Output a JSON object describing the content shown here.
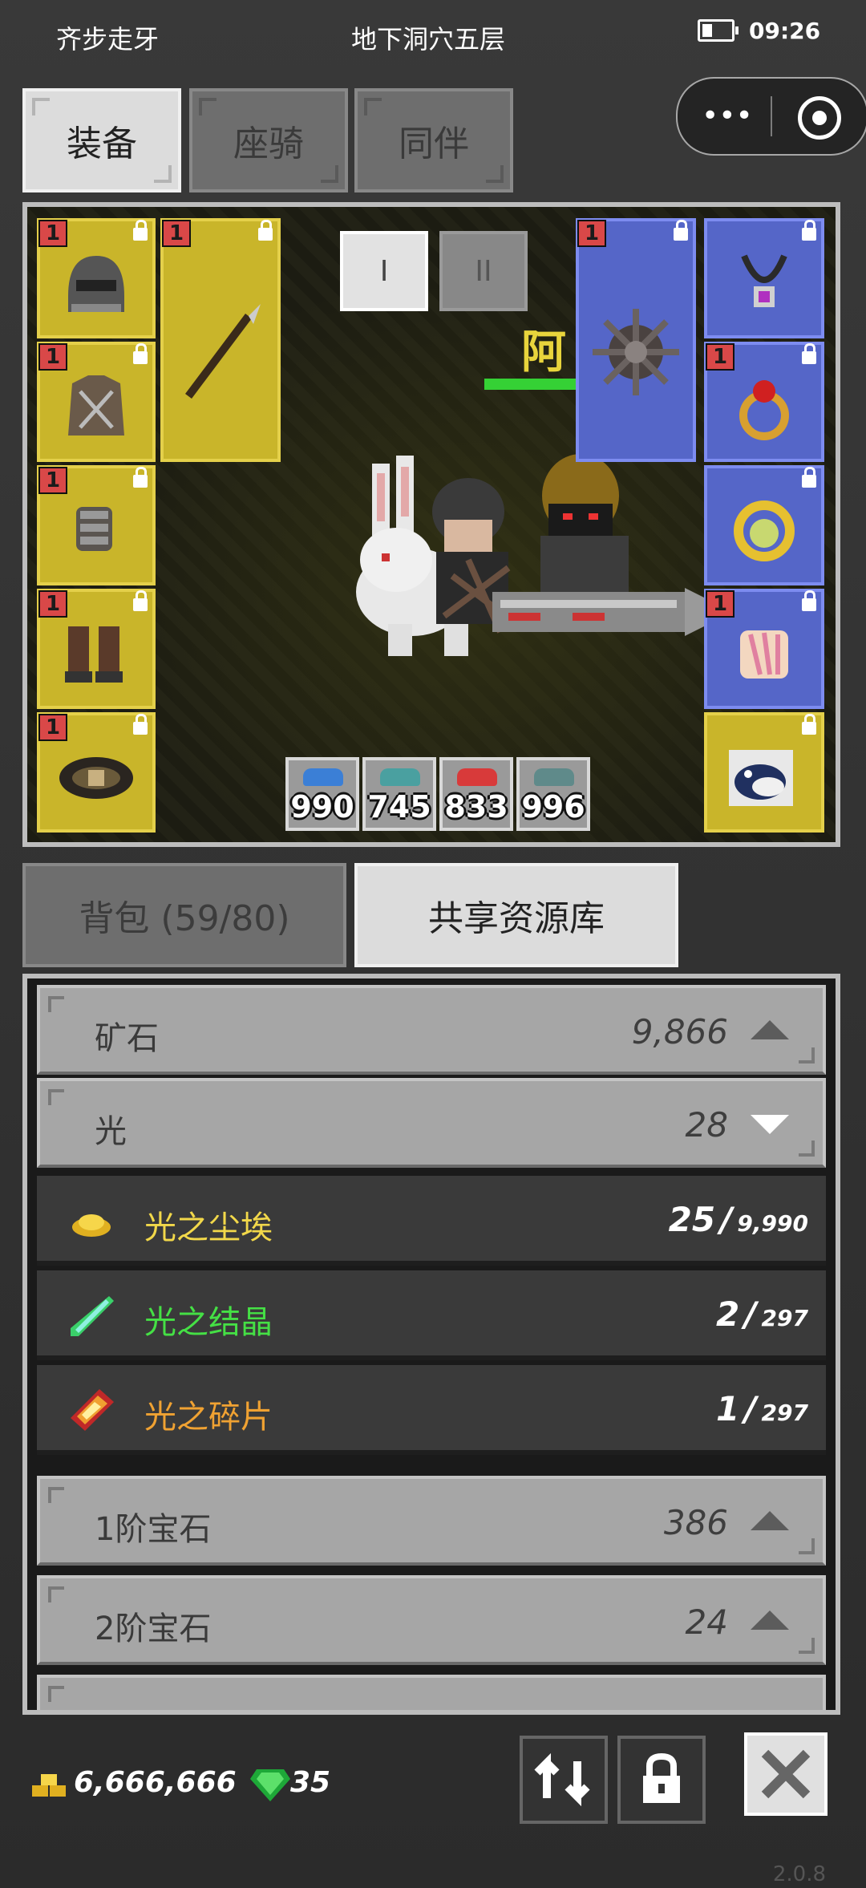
{
  "status_bar": {
    "left_text": "齐步走牙",
    "location": "地下洞穴五层",
    "time": "09:26"
  },
  "capsule": {
    "more_glyph": "•••"
  },
  "top_tabs": [
    {
      "label": "装备",
      "active": true
    },
    {
      "label": "座骑",
      "active": false
    },
    {
      "label": "同伴",
      "active": false
    }
  ],
  "equipment": {
    "page_tabs": [
      "I",
      "II"
    ],
    "character_name_partial": "阿",
    "left_slots": [
      {
        "type": "helmet",
        "level": "1"
      },
      {
        "type": "armor",
        "level": "1"
      },
      {
        "type": "gloves",
        "level": "1"
      },
      {
        "type": "boots",
        "level": "1"
      },
      {
        "type": "belt",
        "level": "1"
      }
    ],
    "weapon_slot": {
      "type": "spear",
      "level": "1"
    },
    "offhand_slot": {
      "type": "spiked-shield",
      "level": "1"
    },
    "right_slots": [
      {
        "type": "necklace",
        "level": ""
      },
      {
        "type": "ring",
        "level": "1"
      },
      {
        "type": "gold-ring",
        "level": ""
      },
      {
        "type": "wings",
        "level": "1"
      },
      {
        "type": "pet-bird",
        "level": ""
      }
    ],
    "stats": [
      {
        "value": "990",
        "color": "#3b7fd6"
      },
      {
        "value": "745",
        "color": "#4aa0a0"
      },
      {
        "value": "833",
        "color": "#d83a3a"
      },
      {
        "value": "996",
        "color": "#5f8a8a"
      }
    ]
  },
  "bottom_tabs": [
    {
      "label": "背包 (59/80)",
      "active": false
    },
    {
      "label": "共享资源库",
      "active": true
    }
  ],
  "resources": {
    "categories": [
      {
        "name": "矿石",
        "count": "9,866",
        "expanded": false
      },
      {
        "name": "光",
        "count": "28",
        "expanded": true
      },
      {
        "name": "1阶宝石",
        "count": "386",
        "expanded": false
      },
      {
        "name": "2阶宝石",
        "count": "24",
        "expanded": false
      }
    ],
    "items": [
      {
        "name": "光之尘埃",
        "qty": "25",
        "max": "9,990",
        "color": "#f2d84a"
      },
      {
        "name": "光之结晶",
        "qty": "2",
        "max": "297",
        "color": "#45e045"
      },
      {
        "name": "光之碎片",
        "qty": "1",
        "max": "297",
        "color": "#f0a232"
      }
    ]
  },
  "footer": {
    "gold": "6,666,666",
    "gems": "35",
    "version": "2.0.8"
  }
}
